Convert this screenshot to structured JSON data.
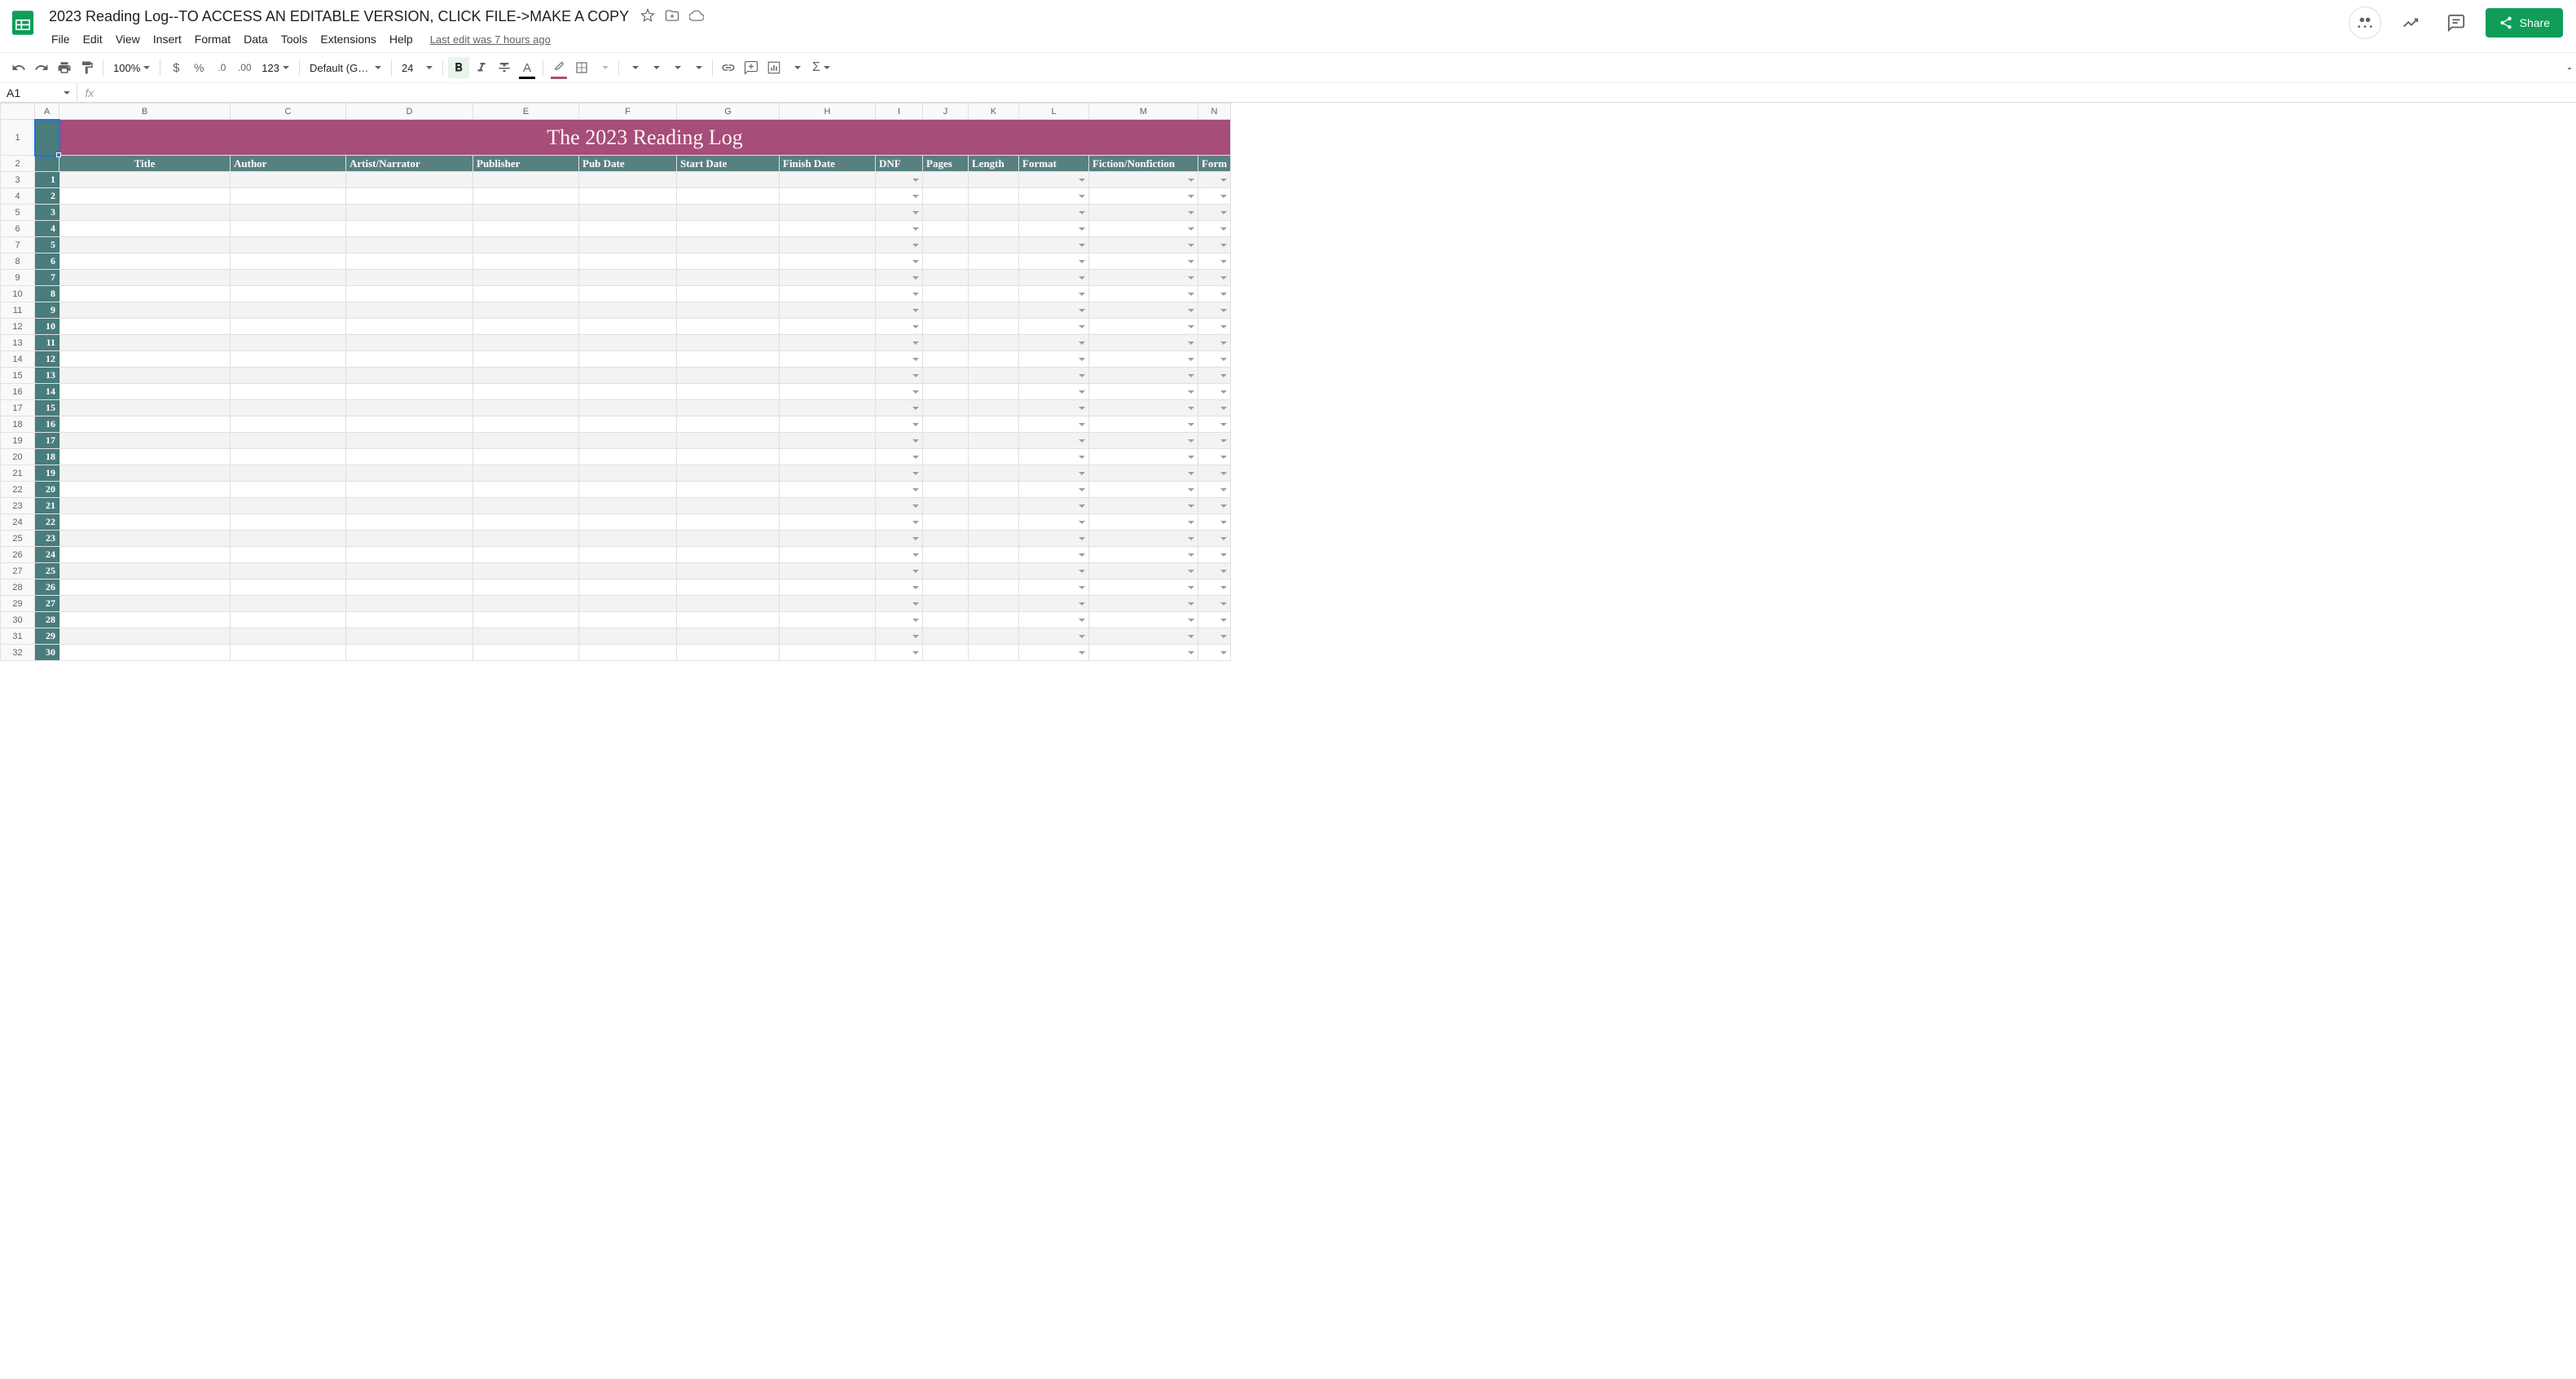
{
  "doc": {
    "title": "2023 Reading Log--TO ACCESS AN EDITABLE VERSION, CLICK FILE->MAKE A COPY",
    "last_edit": "Last edit was 7 hours ago"
  },
  "menu": {
    "file": "File",
    "edit": "Edit",
    "view": "View",
    "insert": "Insert",
    "format": "Format",
    "data": "Data",
    "tools": "Tools",
    "extensions": "Extensions",
    "help": "Help"
  },
  "share": {
    "label": "Share"
  },
  "toolbar": {
    "zoom": "100%",
    "format_123": "123",
    "font": "Default (Ge...",
    "font_size": "24",
    "decrease_decimal": ".0",
    "increase_decimal": ".00"
  },
  "name_box": {
    "value": "A1",
    "fx": "fx"
  },
  "columns": [
    "A",
    "B",
    "C",
    "D",
    "E",
    "F",
    "G",
    "H",
    "I",
    "J",
    "K",
    "L",
    "M",
    "N"
  ],
  "banner": {
    "title": "The 2023 Reading Log"
  },
  "headers": {
    "A": "",
    "B": "Title",
    "C": "Author",
    "D": "Artist/Narrator",
    "E": "Publisher",
    "F": "Pub Date",
    "G": "Start Date",
    "H": "Finish Date",
    "I": "DNF",
    "J": "Pages",
    "K": "Length",
    "L": "Format",
    "M": "Fiction/Nonfiction",
    "N": "Form"
  },
  "dropdown_cols": [
    "I",
    "L",
    "M",
    "N"
  ],
  "row_count": 30,
  "chart_data": null
}
